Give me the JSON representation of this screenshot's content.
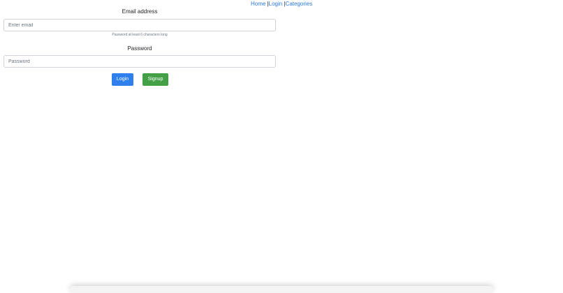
{
  "nav": {
    "home": "Home",
    "sep1": " |",
    "login": "Login",
    "sep2": " |",
    "categories": "Categories"
  },
  "form": {
    "email_label": "Email address",
    "email_placeholder": "Enter email",
    "email_help": "Password at least 6 characters long",
    "password_label": "Password",
    "password_placeholder": "Password",
    "login_button": "Login",
    "signup_button": "Signup"
  },
  "colors": {
    "link": "#2a7ae2",
    "primary": "#2f80ed",
    "success": "#43a047"
  }
}
